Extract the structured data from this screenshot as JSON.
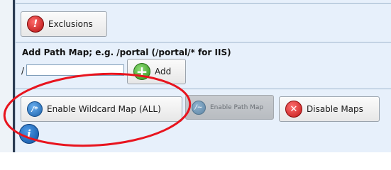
{
  "exclusions_button": {
    "label": "Exclusions",
    "icon": "exclamation-icon"
  },
  "add_path_map": {
    "heading": "Add Path Map; e.g. /portal (/portal/* for IIS)",
    "prefix": "/",
    "input_value": "",
    "add_label": "Add"
  },
  "actions": {
    "enable_wildcard_label": "Enable Wildcard Map (ALL)",
    "enable_path_label": "Enable Path Map",
    "disable_maps_label": "Disable Maps"
  },
  "annotation_color": "#e8141e",
  "colors": {
    "panel_bg": "#e7f0fb",
    "border": "#9fb6cd"
  }
}
